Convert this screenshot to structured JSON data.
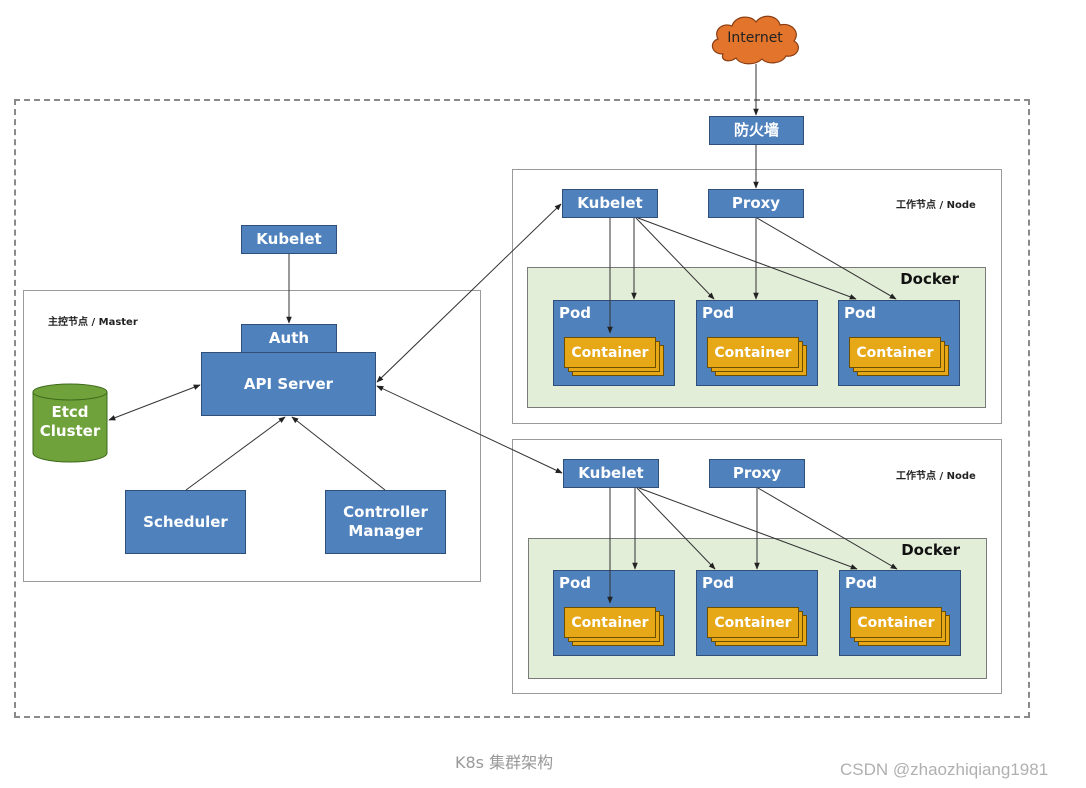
{
  "internet": {
    "label": "Internet",
    "color": "#e2742c"
  },
  "firewall": {
    "label": "防火墙"
  },
  "master": {
    "title": "主控节点 / Master",
    "kubelet": "Kubelet",
    "auth": "Auth",
    "api_server": "API Server",
    "etcd": {
      "line1": "Etcd",
      "line2": "Cluster",
      "color": "#6fa23a"
    },
    "scheduler": "Scheduler",
    "controller_manager": {
      "line1": "Controller",
      "line2": "Manager"
    }
  },
  "nodes": [
    {
      "title": "工作节点 / Node",
      "kubelet": "Kubelet",
      "proxy": "Proxy",
      "docker": "Docker",
      "pods": [
        {
          "label": "Pod",
          "container": "Container"
        },
        {
          "label": "Pod",
          "container": "Container"
        },
        {
          "label": "Pod",
          "container": "Container"
        }
      ]
    },
    {
      "title": "工作节点 / Node",
      "kubelet": "Kubelet",
      "proxy": "Proxy",
      "docker": "Docker",
      "pods": [
        {
          "label": "Pod",
          "container": "Container"
        },
        {
          "label": "Pod",
          "container": "Container"
        },
        {
          "label": "Pod",
          "container": "Container"
        }
      ]
    }
  ],
  "caption": "K8s 集群架构",
  "watermark": "CSDN @zhaozhiqiang1981",
  "colors": {
    "component_blue": "#4f81bd",
    "container_gold": "#e6a817",
    "docker_bg": "#e3eed9"
  }
}
